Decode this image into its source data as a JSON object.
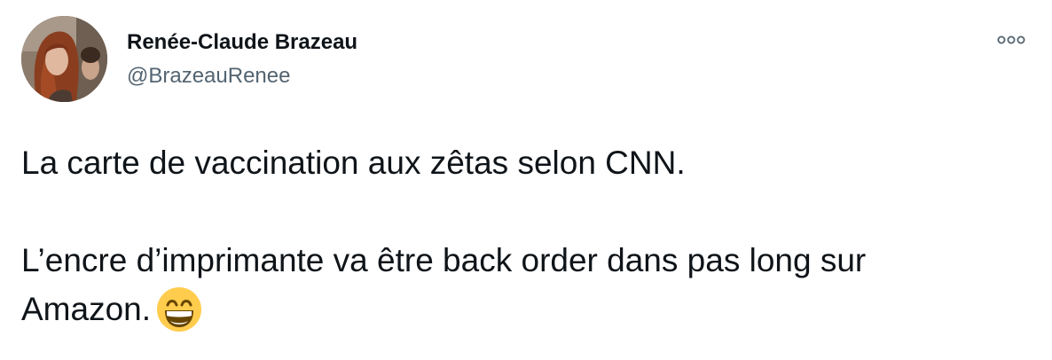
{
  "tweet": {
    "author": {
      "display_name": "Renée-Claude Brazeau",
      "handle": "@BrazeauRenee"
    },
    "more_icon": "more-horizontal-icon",
    "text": {
      "line1": "La carte de vaccination aux zêtas selon CNN.",
      "line2": "L’encre d’imprimante va être back order dans pas long sur",
      "line3": "Amazon."
    },
    "emoji": "grinning-face-with-smiling-eyes-emoji"
  },
  "colors": {
    "text": "#0f1419",
    "secondary_text": "#536471",
    "emoji_face": "#ffcc4d"
  }
}
